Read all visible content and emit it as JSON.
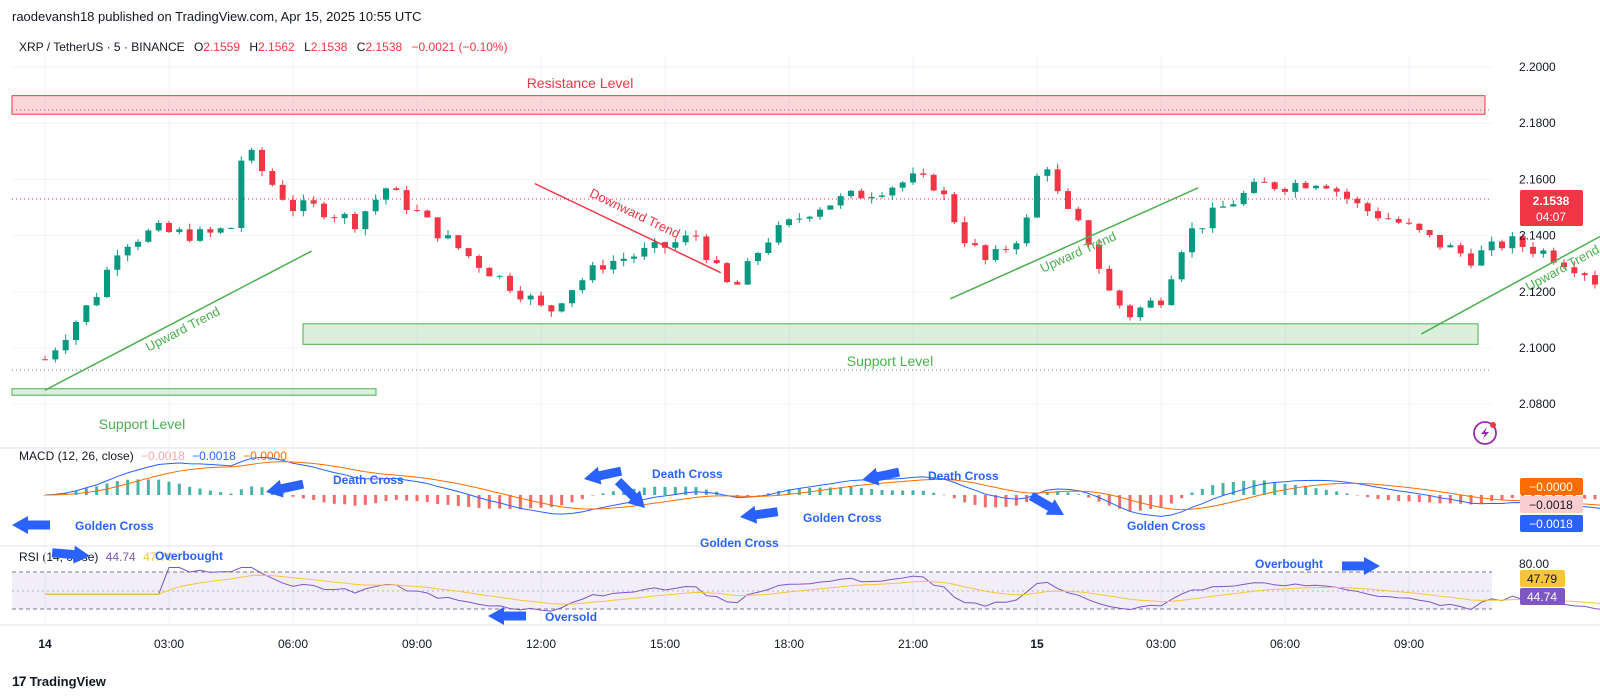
{
  "header": {
    "publisher": "raodevansh18 published on TradingView.com, Apr 15, 2025 10:55 UTC"
  },
  "symbol": {
    "name": "XRP / TetherUS · 5 · BINANCE",
    "open_label": "O",
    "open": "2.1559",
    "high_label": "H",
    "high": "2.1562",
    "low_label": "L",
    "low": "2.1538",
    "close_label": "C",
    "close": "2.1538",
    "change": "−0.0021 (−0.10%)"
  },
  "price_axis": {
    "ticks": [
      "2.2000",
      "2.1800",
      "2.1600",
      "2.1400",
      "2.1200",
      "2.1000",
      "2.0800"
    ],
    "last_price": "2.1538",
    "countdown": "04:07"
  },
  "annotations": {
    "resistance": "Resistance Level",
    "support_main": "Support Level",
    "support_low": "Support Level",
    "upward_trend": "Upward Trend",
    "downward_trend": "Downward Trend"
  },
  "macd": {
    "legend_name": "MACD (12, 26, close)",
    "hist": "−0.0018",
    "macd": "−0.0018",
    "signal": "−0.0000",
    "axis_labels": [
      "−0.0000",
      "−0.0018",
      "−0.0018"
    ],
    "golden_cross": "Golden Cross",
    "death_cross": "Death Cross"
  },
  "rsi": {
    "legend_name": "RSI (14, close)",
    "rsi": "44.74",
    "ma": "47.79",
    "axis_80": "80.00",
    "overbought": "Overbought",
    "oversold": "Oversold"
  },
  "time_axis": [
    "14",
    "03:00",
    "06:00",
    "09:00",
    "12:00",
    "15:00",
    "18:00",
    "21:00",
    "15",
    "03:00",
    "06:00",
    "09:00"
  ],
  "footer": {
    "brand": "TradingView"
  },
  "colors": {
    "up": "#089981",
    "down": "#f23645",
    "accent_blue": "#2962ff",
    "orange": "#ff6d00",
    "purple": "#7e57c2",
    "green_zone": "#4caf50"
  },
  "chart_data": {
    "type": "candlestick",
    "title": "XRP / TetherUS · 5 · BINANCE",
    "x": [
      "14",
      "03:00",
      "06:00",
      "09:00",
      "12:00",
      "15:00",
      "18:00",
      "21:00",
      "15",
      "03:00",
      "06:00",
      "09:00"
    ],
    "ylim": [
      2.075,
      2.205
    ],
    "close_path": [
      {
        "x": 0,
        "y": 2.096
      },
      {
        "x": 0.4,
        "y": 2.118
      },
      {
        "x": 0.6,
        "y": 2.137
      },
      {
        "x": 0.9,
        "y": 2.142
      },
      {
        "x": 1.0,
        "y": 2.141
      },
      {
        "x": 1.3,
        "y": 2.14
      },
      {
        "x": 1.5,
        "y": 2.143
      },
      {
        "x": 1.6,
        "y": 2.172
      },
      {
        "x": 1.8,
        "y": 2.16
      },
      {
        "x": 2.0,
        "y": 2.15
      },
      {
        "x": 2.2,
        "y": 2.15
      },
      {
        "x": 2.5,
        "y": 2.145
      },
      {
        "x": 2.75,
        "y": 2.157
      },
      {
        "x": 3.0,
        "y": 2.148
      },
      {
        "x": 3.2,
        "y": 2.14
      },
      {
        "x": 3.5,
        "y": 2.13
      },
      {
        "x": 3.9,
        "y": 2.118
      },
      {
        "x": 4.05,
        "y": 2.112
      },
      {
        "x": 4.2,
        "y": 2.12
      },
      {
        "x": 4.5,
        "y": 2.13
      },
      {
        "x": 5.0,
        "y": 2.136
      },
      {
        "x": 5.25,
        "y": 2.14
      },
      {
        "x": 5.45,
        "y": 2.125
      },
      {
        "x": 5.55,
        "y": 2.12
      },
      {
        "x": 5.8,
        "y": 2.138
      },
      {
        "x": 6.2,
        "y": 2.15
      },
      {
        "x": 6.6,
        "y": 2.155
      },
      {
        "x": 7.0,
        "y": 2.16
      },
      {
        "x": 7.2,
        "y": 2.158
      },
      {
        "x": 7.4,
        "y": 2.14
      },
      {
        "x": 7.6,
        "y": 2.13
      },
      {
        "x": 7.9,
        "y": 2.142
      },
      {
        "x": 8.05,
        "y": 2.17
      },
      {
        "x": 8.2,
        "y": 2.15
      },
      {
        "x": 8.4,
        "y": 2.14
      },
      {
        "x": 8.6,
        "y": 2.118
      },
      {
        "x": 8.75,
        "y": 2.112
      },
      {
        "x": 9.0,
        "y": 2.118
      },
      {
        "x": 9.2,
        "y": 2.14
      },
      {
        "x": 9.5,
        "y": 2.15
      },
      {
        "x": 9.8,
        "y": 2.158
      },
      {
        "x": 10.0,
        "y": 2.158
      },
      {
        "x": 10.3,
        "y": 2.16
      },
      {
        "x": 10.6,
        "y": 2.15
      },
      {
        "x": 10.9,
        "y": 2.145
      },
      {
        "x": 11.2,
        "y": 2.138
      },
      {
        "x": 11.5,
        "y": 2.132
      },
      {
        "x": 11.8,
        "y": 2.138
      },
      {
        "x": 12.1,
        "y": 2.134
      },
      {
        "x": 12.4,
        "y": 2.128
      },
      {
        "x": 12.6,
        "y": 2.12
      },
      {
        "x": 12.75,
        "y": 2.126
      },
      {
        "x": 13.0,
        "y": 2.136
      },
      {
        "x": 13.3,
        "y": 2.125
      },
      {
        "x": 13.5,
        "y": 2.13
      },
      {
        "x": 13.8,
        "y": 2.123
      },
      {
        "x": 14.1,
        "y": 2.135
      },
      {
        "x": 14.4,
        "y": 2.15
      },
      {
        "x": 14.8,
        "y": 2.148
      },
      {
        "x": 15.1,
        "y": 2.145
      },
      {
        "x": 15.4,
        "y": 2.15
      },
      {
        "x": 15.7,
        "y": 2.155
      },
      {
        "x": 16.0,
        "y": 2.15
      },
      {
        "x": 16.3,
        "y": 2.145
      },
      {
        "x": 16.7,
        "y": 2.142
      },
      {
        "x": 17.0,
        "y": 2.132
      },
      {
        "x": 17.3,
        "y": 2.145
      },
      {
        "x": 17.6,
        "y": 2.152
      },
      {
        "x": 18.0,
        "y": 2.15
      },
      {
        "x": 18.4,
        "y": 2.156
      },
      {
        "x": 18.65,
        "y": 2.162
      },
      {
        "x": 18.8,
        "y": 2.183
      },
      {
        "x": 18.95,
        "y": 2.172
      },
      {
        "x": 19.1,
        "y": 2.168
      },
      {
        "x": 19.4,
        "y": 2.165
      },
      {
        "x": 19.6,
        "y": 2.158
      },
      {
        "x": 19.8,
        "y": 2.15
      },
      {
        "x": 19.95,
        "y": 2.154
      }
    ],
    "resistance_zone": [
      2.1832,
      2.1898
    ],
    "support_zone_main": [
      2.1013,
      2.1086
    ],
    "support_zone_low": [
      2.0832,
      2.0855
    ],
    "trendlines": [
      {
        "label": "Upward Trend",
        "from": [
          0.0,
          2.085
        ],
        "to": [
          2.15,
          2.1345
        ]
      },
      {
        "label": "Downward Trend",
        "from": [
          3.95,
          2.1585
        ],
        "to": [
          5.45,
          2.1268
        ]
      },
      {
        "label": "Upward Trend",
        "from": [
          7.3,
          2.1175
        ],
        "to": [
          9.3,
          2.157
        ]
      },
      {
        "label": "Upward Trend",
        "from": [
          11.1,
          2.105
        ],
        "to": [
          13.3,
          2.158
        ]
      },
      {
        "label": "Downward Trend",
        "from": [
          13.6,
          2.1635
        ],
        "to": [
          16.85,
          2.1297
        ]
      },
      {
        "label": "Upward Trend",
        "from": [
          17.8,
          2.1155
        ],
        "to": [
          22.7,
          2.1375
        ]
      }
    ],
    "macd_levels": {
      "macd": -0.0018,
      "signal": -0.0,
      "histogram": -0.0018
    },
    "rsi_levels": {
      "rsi": 44.74,
      "ma": 47.79,
      "upper": 80,
      "lower": 30
    }
  }
}
